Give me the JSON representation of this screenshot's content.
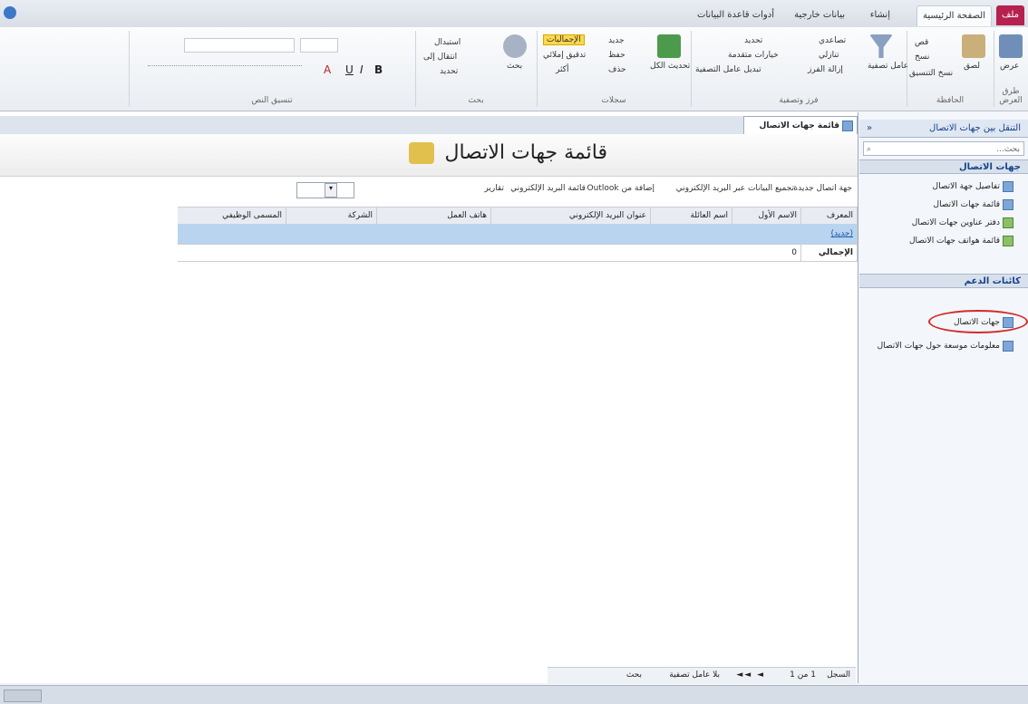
{
  "ribbon_tabs": {
    "file": "ملف",
    "home": "الصفحة الرئيسية",
    "create": "إنشاء",
    "external": "بيانات خارجية",
    "dbtools": "أدوات قاعدة البيانات"
  },
  "ribbon": {
    "groups": {
      "views": "طرق العرض",
      "clipboard": "الحافظة",
      "sort_filter": "فرز وتصفية",
      "records": "سجلات",
      "find": "بحث",
      "text_format": "تنسيق النص"
    },
    "view": "عرض",
    "paste": "لصق",
    "cut": "قص",
    "copy": "نسخ",
    "format_painter": "نسخ التنسيق",
    "filter": "عامل تصفية",
    "ascending": "تصاعدي",
    "descending": "تنازلي",
    "remove_sort": "إزالة الفرز",
    "selection": "تحديد",
    "advanced": "خيارات متقدمة",
    "toggle_filter": "تبديل عامل التصفية",
    "refresh_all": "تحديث الكل",
    "new": "جديد",
    "save": "حفظ",
    "delete": "حذف",
    "totals": "الإجماليات",
    "spelling": "تدقيق إملائي",
    "more": "أكثر",
    "find": "بحث",
    "replace": "استبدال",
    "goto": "انتقال إلى",
    "select": "تحديد"
  },
  "nav": {
    "header": "التنقل بين جهات الاتصال",
    "search_placeholder": "بحث...",
    "group1": "جهات الاتصال",
    "items1": [
      "تفاصيل جهة الاتصال",
      "قائمة جهات الاتصال",
      "دفتر عناوين جهات الاتصال",
      "قائمة هواتف جهات الاتصال"
    ],
    "group2": "كائنات الدعم",
    "items2": [
      "جهات الاتصال",
      "معلومات موسعة حول جهات الاتصال"
    ]
  },
  "doc": {
    "tab_title": "قائمة جهات الاتصال",
    "form_title": "قائمة جهات الاتصال",
    "toolbar": [
      "جهة اتصال جديدة",
      "تجميع البيانات عبر البريد الإلكتروني",
      "إضافة من Outlook",
      "قائمة البريد الإلكتروني",
      "تقارير"
    ],
    "columns": [
      "المعرف",
      "الاسم الأول",
      "اسم العائلة",
      "عنوان البريد الإلكتروني",
      "هاتف العمل",
      "الشركة",
      "المسمى الوظيفي"
    ],
    "new_row": "(جديد)",
    "total_label": "الإجمالي",
    "total_value": "0"
  },
  "record_nav": {
    "label": "السجل",
    "position": "1 من 1",
    "no_filter": "بلا عامل تصفية",
    "search": "بحث"
  },
  "colors": {
    "file_tab": "#b6214f",
    "accent": "#15428b",
    "selected_row": "#b9d4ee",
    "circle": "#d12b2b"
  }
}
